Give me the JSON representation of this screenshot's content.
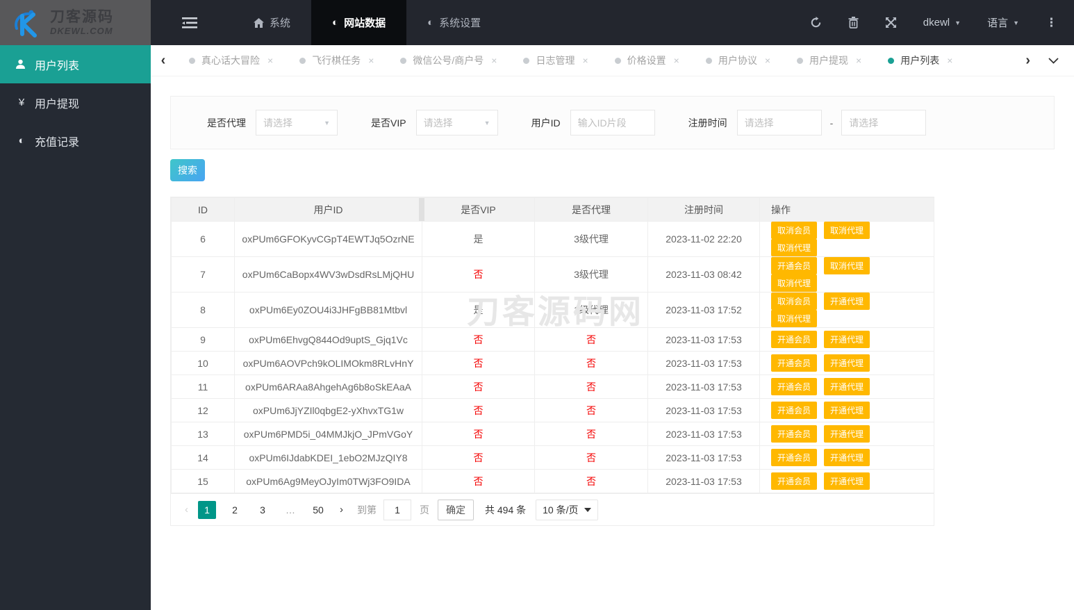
{
  "logo": {
    "brand": "刀客源码",
    "domain": "DKEWL.COM"
  },
  "topnav": {
    "items": [
      {
        "label": "系统",
        "icon": "home-icon",
        "active": false
      },
      {
        "label": "网站数据",
        "icon": "half-circle-icon",
        "active": true
      },
      {
        "label": "系统设置",
        "icon": "half-circle-icon",
        "active": false
      }
    ],
    "username": "dkewl",
    "language_label": "语言"
  },
  "tabbar": {
    "tabs": [
      {
        "label": "真心话大冒险",
        "active": false
      },
      {
        "label": "飞行棋任务",
        "active": false
      },
      {
        "label": "微信公号/商户号",
        "active": false
      },
      {
        "label": "日志管理",
        "active": false
      },
      {
        "label": "价格设置",
        "active": false
      },
      {
        "label": "用户协议",
        "active": false
      },
      {
        "label": "用户提现",
        "active": false
      },
      {
        "label": "用户列表",
        "active": true
      }
    ],
    "close_glyph": "×",
    "prev_glyph": "‹",
    "next_glyph": "›"
  },
  "sidebar": {
    "items": [
      {
        "label": "用户列表",
        "icon": "user-icon",
        "glyph": "",
        "active": true
      },
      {
        "label": "用户提现",
        "icon": "yen-icon",
        "glyph": "¥",
        "active": false
      },
      {
        "label": "充值记录",
        "icon": "half-circle-icon",
        "glyph": "◐",
        "active": false
      }
    ]
  },
  "filters": {
    "agent_label": "是否代理",
    "vip_label": "是否VIP",
    "select_placeholder": "请选择",
    "userid_label": "用户ID",
    "userid_placeholder": "输入ID片段",
    "regtime_label": "注册时间",
    "date_placeholder": "请选择",
    "range_separator": "-"
  },
  "search_button_label": "搜索",
  "table": {
    "columns": [
      "ID",
      "用户ID",
      "是否VIP",
      "是否代理",
      "注册时间",
      "操作"
    ],
    "rows": [
      {
        "id": "6",
        "user_id": "oxPUm6GFOKyvCGpT4EWTJq5OzrNE",
        "vip": "是",
        "agent": "3级代理",
        "reg_time": "2023-11-02 22:20",
        "actions": [
          "取消会员",
          "取消代理",
          "取消代理"
        ]
      },
      {
        "id": "7",
        "user_id": "oxPUm6CaBopx4WV3wDsdRsLMjQHU",
        "vip": "否",
        "agent": "3级代理",
        "reg_time": "2023-11-03 08:42",
        "actions": [
          "开通会员",
          "取消代理",
          "取消代理"
        ]
      },
      {
        "id": "8",
        "user_id": "oxPUm6Ey0ZOU4i3JHFgBB81Mtbvl",
        "vip": "是",
        "agent": "1级代理",
        "reg_time": "2023-11-03 17:52",
        "actions": [
          "取消会员",
          "开通代理",
          "取消代理"
        ]
      },
      {
        "id": "9",
        "user_id": "oxPUm6EhvgQ844Od9uptS_Gjq1Vc",
        "vip": "否",
        "agent": "否",
        "reg_time": "2023-11-03 17:53",
        "actions": [
          "开通会员",
          "开通代理"
        ]
      },
      {
        "id": "10",
        "user_id": "oxPUm6AOVPch9kOLIMOkm8RLvHnY",
        "vip": "否",
        "agent": "否",
        "reg_time": "2023-11-03 17:53",
        "actions": [
          "开通会员",
          "开通代理"
        ]
      },
      {
        "id": "11",
        "user_id": "oxPUm6ARAa8AhgehAg6b8oSkEAaA",
        "vip": "否",
        "agent": "否",
        "reg_time": "2023-11-03 17:53",
        "actions": [
          "开通会员",
          "开通代理"
        ]
      },
      {
        "id": "12",
        "user_id": "oxPUm6JjYZIl0qbgE2-yXhvxTG1w",
        "vip": "否",
        "agent": "否",
        "reg_time": "2023-11-03 17:53",
        "actions": [
          "开通会员",
          "开通代理"
        ]
      },
      {
        "id": "13",
        "user_id": "oxPUm6PMD5i_04MMJkjO_JPmVGoY",
        "vip": "否",
        "agent": "否",
        "reg_time": "2023-11-03 17:53",
        "actions": [
          "开通会员",
          "开通代理"
        ]
      },
      {
        "id": "14",
        "user_id": "oxPUm6IJdabKDEI_1ebO2MJzQIY8",
        "vip": "否",
        "agent": "否",
        "reg_time": "2023-11-03 17:53",
        "actions": [
          "开通会员",
          "开通代理"
        ]
      },
      {
        "id": "15",
        "user_id": "oxPUm6Ag9MeyOJyIm0TWj3FO9IDA",
        "vip": "否",
        "agent": "否",
        "reg_time": "2023-11-03 17:53",
        "actions": [
          "开通会员",
          "开通代理"
        ]
      }
    ]
  },
  "pagination": {
    "prev_glyph": "‹",
    "pages": [
      "1",
      "2",
      "3",
      "…",
      "50"
    ],
    "active_page": "1",
    "next_glyph": "›",
    "goto_label": "到第",
    "goto_value": "1",
    "page_unit": "页",
    "confirm_label": "确定",
    "total_label": "共 494 条",
    "page_size_label": "10 条/页"
  },
  "watermark": "刀客源码网",
  "colors": {
    "accent_teal": "#1aa094",
    "pagination_active": "#009688",
    "action_button_yellow": "#ffb800",
    "danger_red": "#f40000",
    "topbar_bg": "#23262e",
    "sidebar_bg": "#252a33",
    "nav_active_bg": "#0b0d10",
    "logo_bg": "#58585a",
    "search_gradient_start": "#3fc6c9",
    "search_gradient_end": "#48a4f2"
  }
}
